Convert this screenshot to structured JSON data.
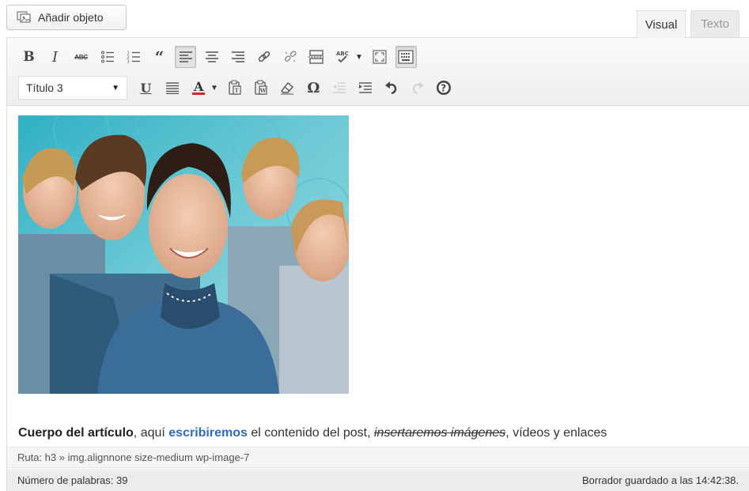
{
  "toolbar_top": {
    "add_media_label": "Añadir objeto"
  },
  "tabs": [
    {
      "label": "Visual",
      "active": true
    },
    {
      "label": "Texto",
      "active": false
    }
  ],
  "toolbar": {
    "row1": [
      "bold-icon",
      "italic-icon",
      "strikethrough-icon",
      "bulleted-list-icon",
      "numbered-list-icon",
      "blockquote-icon",
      "align-left-icon",
      "align-center-icon",
      "align-right-icon",
      "insert-link-icon",
      "remove-link-icon",
      "insert-more-tag-icon",
      "spellcheck-icon",
      "fullscreen-icon",
      "toolbar-toggle-icon"
    ],
    "row2": [
      "format-select",
      "underline-icon",
      "justify-icon",
      "text-color-icon",
      "paste-as-text-icon",
      "paste-from-word-icon",
      "clear-formatting-icon",
      "special-character-icon",
      "outdent-icon",
      "indent-icon",
      "undo-icon",
      "redo-icon",
      "help-icon"
    ],
    "bold_label": "B",
    "italic_label": "I",
    "strike_label": "ABC",
    "quote_label": "“",
    "underline_label": "U",
    "text_color_label": "A",
    "omega_label": "Ω",
    "spell_label": "ABC",
    "format_value": "Título 3",
    "text_color": "#d9262b",
    "active_button": "align-left-icon"
  },
  "content": {
    "image_class": "img.alignnone size-medium wp-image-7",
    "paragraph": {
      "part1": "Cuerpo del artículo",
      "part2": ", aquí ",
      "part3": "escribiremos",
      "part4": " el contenido del post, ",
      "part5": "insertaremos imágenes",
      "part6": ", vídeos y enlaces"
    }
  },
  "pathbar": {
    "text": "Ruta: h3 » img.alignnone size-medium wp-image-7"
  },
  "status": {
    "word_count": "Número de palabras: 39",
    "draft_saved": "Borrador guardado a las 14:42:38."
  },
  "colors": {
    "link": "#2e6ccc",
    "toolbar_bg": "#f1f1f1",
    "status_bg": "#ececec"
  }
}
